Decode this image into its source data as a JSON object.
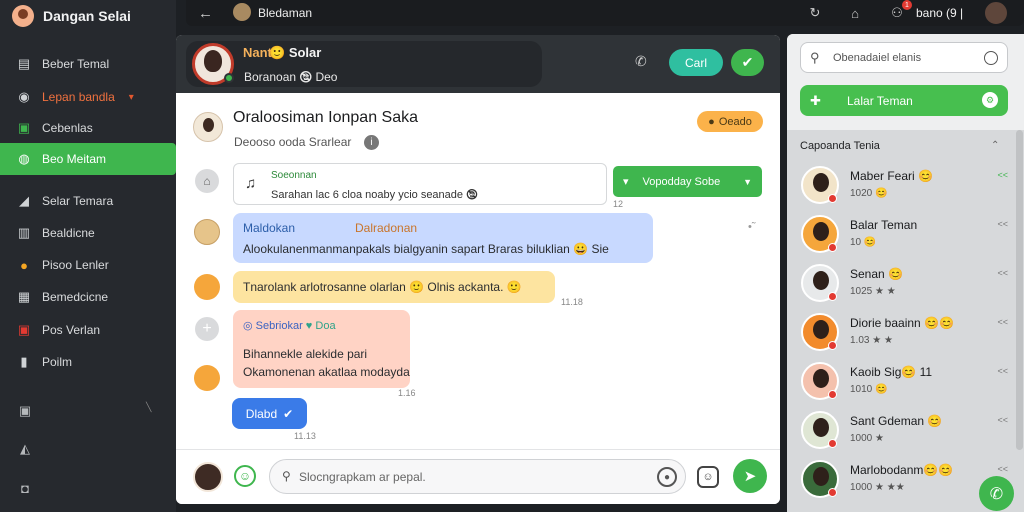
{
  "app": {
    "brand": "Dangan Selai"
  },
  "sidebar": {
    "items": [
      {
        "label": "Beber Temal",
        "icon": "bookmark-icon"
      },
      {
        "label": "Lepan bandla",
        "icon": "user-icon",
        "accent": "#f0713f"
      },
      {
        "label": "Cebenlas",
        "icon": "chat-icon"
      },
      {
        "label": "Beo Meitam",
        "icon": "contacts-icon",
        "active": true
      },
      {
        "label": "Selar Temara",
        "icon": "megaphone-icon"
      },
      {
        "label": "Bealdicne",
        "icon": "image-icon"
      },
      {
        "label": "Pisoo Lenler",
        "icon": "sun-icon"
      },
      {
        "label": "Bemedcicne",
        "icon": "calendar-icon"
      },
      {
        "label": "Pos Verlan",
        "icon": "video-icon"
      },
      {
        "label": "Poilm",
        "icon": "document-icon"
      }
    ],
    "bottom_icons": [
      "lock-icon",
      "edit-icon",
      "camera-icon"
    ]
  },
  "topbar": {
    "title": "Bledaman",
    "user_label": "bano (9 |",
    "notification_count": "1"
  },
  "chat": {
    "header": {
      "name_colored": "Nant",
      "name_rest": "Solar",
      "status": "Boranoan 🕲 Deo",
      "call_label": "Carl"
    },
    "contact": {
      "title": "Oraloosiman Ionpan Saka",
      "subtitle": "Deooso ooda Srarlear",
      "tag": "Oeado"
    },
    "pinned": {
      "head": "Soeonnan",
      "text": "Sarahan lac 6 cloa noaby ycio seanade 🕲",
      "button_label": "Vopodday Sobe",
      "time": "12"
    },
    "messages": [
      {
        "sender": "Maldokan",
        "sender2": "Dalradonan",
        "text": "Alookulanenmanmanpakals bialgyanin sapart Braras biluklian 😀 Sie"
      },
      {
        "text": "Tnarolank arlotrosanne olarlan 🙂 Olnis ackanta. 🙂",
        "time": "11.18"
      },
      {
        "sender": "Sebriokar",
        "tag": "Doa",
        "text1": "Bihannekle alekide pari",
        "text2": "Okamonenan akatlaa modayda",
        "time": "1.16"
      },
      {
        "text": "Dlabd",
        "time": "11.13"
      }
    ],
    "composer": {
      "placeholder": "Slocngrapkam ar pepal."
    }
  },
  "right_panel": {
    "search_placeholder": "Obenadaiel elanis",
    "add_button": "Lalar Teman",
    "list_title": "Capoanda Tenia",
    "friends": [
      {
        "name": "Maber Feari 😊",
        "status": "1020 😊",
        "action": "<<"
      },
      {
        "name": "Balar Teman",
        "status": "10 😊",
        "action": "<<"
      },
      {
        "name": "Senan 😊",
        "status": "1025 ★ ★",
        "action": "<<"
      },
      {
        "name": "Diorie baainn 😊😊",
        "status": "1.03 ★ ★",
        "action": "<<"
      },
      {
        "name": "Kaoib Sig😊 11",
        "status": "1010 😊",
        "action": "<<"
      },
      {
        "name": "Sant Gdeman 😊",
        "status": "1000 ★",
        "action": "<<"
      },
      {
        "name": "Marlobodanm😊😊",
        "status": "1000 ★ ★★",
        "action": "<<"
      }
    ]
  },
  "colors": {
    "accent": "#3fb64e",
    "orange": "#f0713f",
    "sidebar": "#26292e"
  }
}
